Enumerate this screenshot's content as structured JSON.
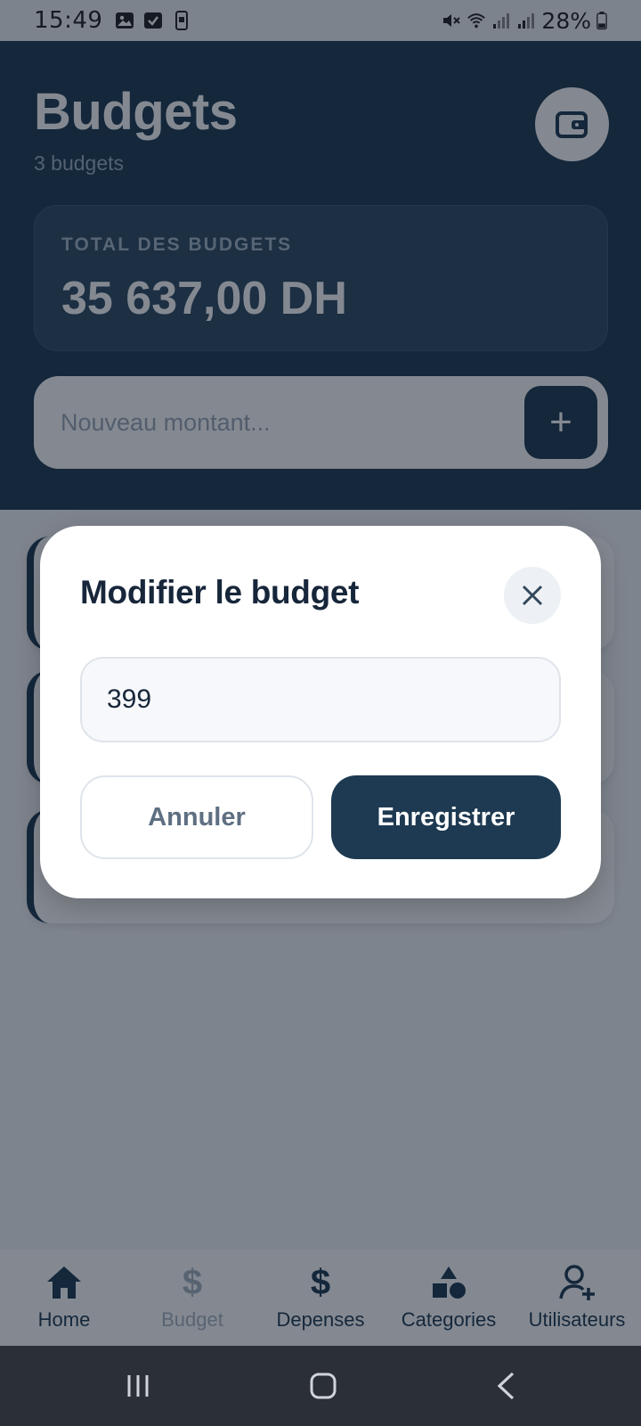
{
  "status_bar": {
    "time": "15:49",
    "battery": "28%"
  },
  "header": {
    "title": "Budgets",
    "subtitle": "3 budgets",
    "total_label": "TOTAL DES BUDGETS",
    "total_value": "35 637,00 DH",
    "amount_placeholder": "Nouveau montant...",
    "add_label": "+"
  },
  "modal": {
    "title": "Modifier le budget",
    "input_value": "399",
    "cancel_label": "Annuler",
    "save_label": "Enregistrer"
  },
  "bottom_nav": {
    "items": [
      {
        "label": "Home",
        "icon": "home-icon"
      },
      {
        "label": "Budget",
        "icon": "dollar-icon",
        "active": true
      },
      {
        "label": "Depenses",
        "icon": "dollar-icon"
      },
      {
        "label": "Categories",
        "icon": "shapes-icon"
      },
      {
        "label": "Utilisateurs",
        "icon": "add-user-icon"
      }
    ]
  },
  "colors": {
    "primary": "#1e3a52",
    "overlay": "rgba(10,20,35,0.5)",
    "nav_active": "#a7b3c0"
  }
}
